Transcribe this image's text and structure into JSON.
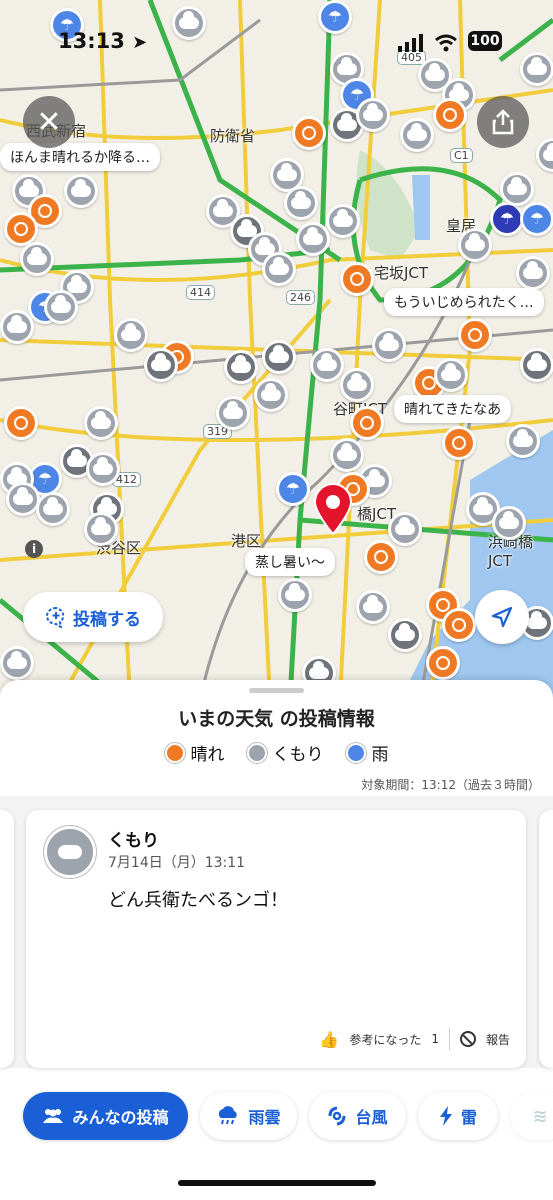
{
  "status_bar": {
    "time": "13:13",
    "battery": "100"
  },
  "map": {
    "place_labels": [
      "西武新宿",
      "防衛省",
      "皇居",
      "港区",
      "渋谷区"
    ],
    "road_labels": [
      "405",
      "C1",
      "414",
      "246",
      "319",
      "412",
      "宅坂JCT",
      "谷町JCT",
      "橋JCT",
      "浜崎橋JCT"
    ],
    "bubbles": [
      "ほんま晴れるか降る…",
      "もういじめられたく…",
      "晴れてきたなあ",
      "蒸し暑い〜"
    ],
    "post_button_label": "投稿する"
  },
  "sheet": {
    "title": "いまの天気 の投稿情報",
    "legend": [
      {
        "label": "晴れ",
        "color": "#f07a24"
      },
      {
        "label": "くもり",
        "color": "#9ea4ad"
      },
      {
        "label": "雨",
        "color": "#4d86e6"
      }
    ],
    "period": "対象期間：13:12（過去３時間）",
    "post": {
      "weather": "くもり",
      "date": "7月14日（月）13:11",
      "text": "どん兵衛たべるンゴ！",
      "helpful_label": "参考になった",
      "helpful_count": "1",
      "report_label": "報告"
    }
  },
  "tabs": [
    {
      "label": "みんなの投稿",
      "icon": "people-icon",
      "active": true
    },
    {
      "label": "雨雲",
      "icon": "rain-cloud-icon",
      "active": false
    },
    {
      "label": "台風",
      "icon": "typhoon-icon",
      "active": false
    },
    {
      "label": "雷",
      "icon": "lightning-icon",
      "active": false
    }
  ],
  "colors": {
    "accent": "#1a5fd6",
    "pin_red": "#e3142c",
    "water": "#9fc7f0"
  }
}
